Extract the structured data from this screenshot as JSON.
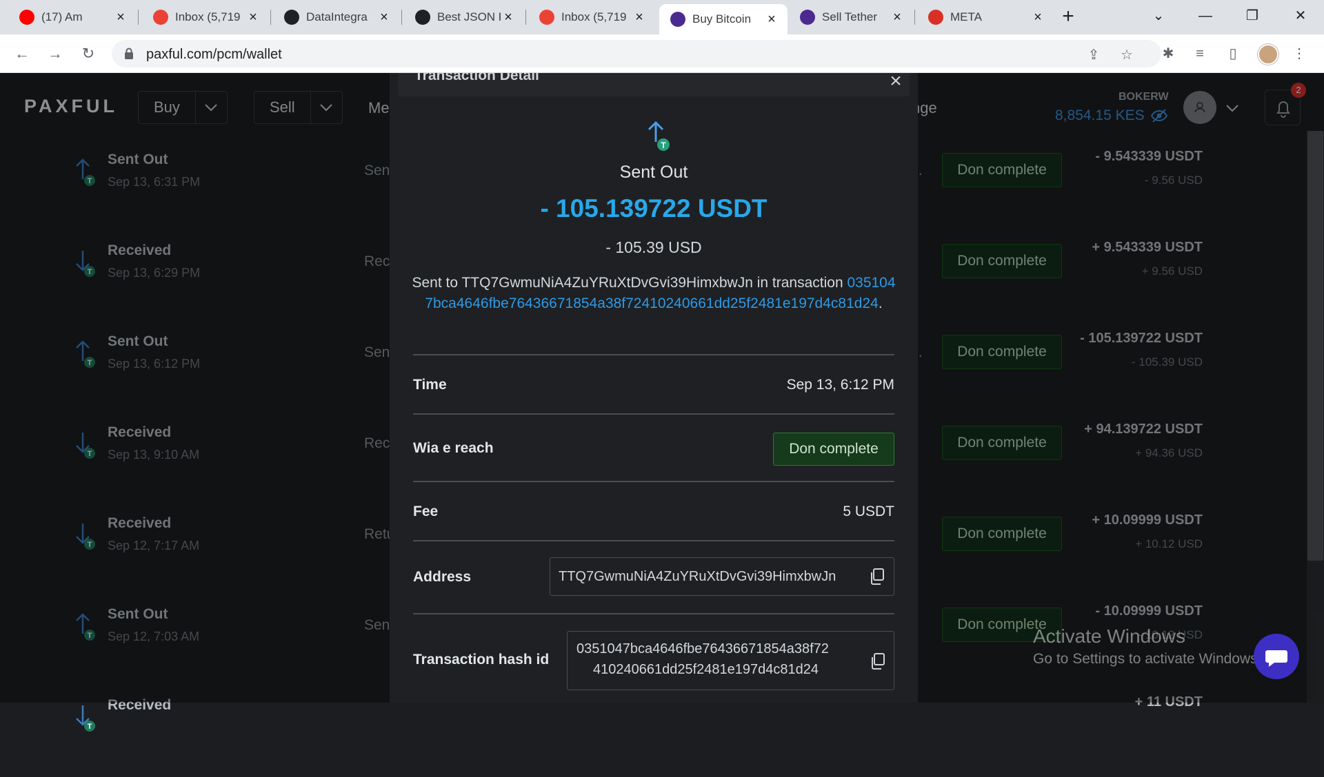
{
  "browser": {
    "tabs": [
      {
        "title": "(17) Am",
        "icon": "youtube-icon",
        "color": "#ff0000"
      },
      {
        "title": "Inbox (5,719",
        "icon": "gmail-icon",
        "color": "#ea4335"
      },
      {
        "title": "DataIntegra",
        "icon": "github-icon",
        "color": "#202124"
      },
      {
        "title": "Best JSON F",
        "icon": "jsonformatter-icon",
        "color": "#202124"
      },
      {
        "title": "Inbox (5,719",
        "icon": "gmail-icon",
        "color": "#ea4335"
      },
      {
        "title": "Buy Bitcoin",
        "icon": "paxful-icon",
        "color": "#4b2a8f",
        "active": true
      },
      {
        "title": "Sell Tether",
        "icon": "paxful-icon",
        "color": "#4b2a8f"
      },
      {
        "title": "META",
        "icon": "meta-trade-icon",
        "color": "#d93025"
      }
    ],
    "url": "paxful.com/pcm/wallet"
  },
  "header": {
    "logo": "PAXFUL",
    "nav": {
      "buy": "Buy",
      "sell": "Sell",
      "more": "Me",
      "exchange": "nge"
    },
    "username": "BOKERW",
    "balance": "8,854.15 KES",
    "notifications": "2"
  },
  "transactions": [
    {
      "label": "Sent Out",
      "date": "Sep 13, 6:31 PM",
      "desc": "Sen",
      "dots": "..",
      "status": "Don complete",
      "amount": "- 9.543339 USDT",
      "usd": "- 9.56  USD",
      "direction": "out"
    },
    {
      "label": "Received",
      "date": "Sep 13, 6:29 PM",
      "desc": "Rec",
      "dots": "",
      "status": "Don complete",
      "amount": "+ 9.543339 USDT",
      "usd": "+ 9.56  USD",
      "direction": "in"
    },
    {
      "label": "Sent Out",
      "date": "Sep 13, 6:12 PM",
      "desc": "Sen",
      "dots": "..",
      "status": "Don complete",
      "amount": "- 105.139722 USDT",
      "usd": "- 105.39  USD",
      "direction": "out"
    },
    {
      "label": "Received",
      "date": "Sep 13, 9:10 AM",
      "desc": "Rec",
      "dots": "",
      "status": "Don complete",
      "amount": "+ 94.139722 USDT",
      "usd": "+ 94.36  USD",
      "direction": "in"
    },
    {
      "label": "Received",
      "date": "Sep 12, 7:17 AM",
      "desc": "Retu",
      "dots": "",
      "status": "Don complete",
      "amount": "+ 10.09999 USDT",
      "usd": "+ 10.12  USD",
      "direction": "in"
    },
    {
      "label": "Sent Out",
      "date": "Sep 12, 7:03 AM",
      "desc": "Sen",
      "dots": "",
      "status": "Don complete",
      "amount": "- 10.09999 USDT",
      "usd": "- 10.12  USD",
      "direction": "out"
    },
    {
      "label": "Received",
      "date": "",
      "desc": "",
      "dots": "",
      "status": "",
      "amount": "+ 11 USDT",
      "usd": "",
      "direction": "in"
    }
  ],
  "modal": {
    "title": "Transaction Detail",
    "type": "Sent Out",
    "amount": "- 105.139722 USDT",
    "fiat": "- 105.39 USD",
    "desc_prefix": "Sent to TTQ7GwmuNiA4ZuYRuXtDvGvi39HimxbwJn in transaction",
    "desc_hash": "0351047bca4646fbe76436671854a38f72410240661dd25f2481e197d4c81d24",
    "desc_suffix": ".",
    "time_label": "Time",
    "time_value": "Sep 13, 6:12 PM",
    "status_label": "Wia e reach",
    "status_value": "Don complete",
    "fee_label": "Fee",
    "fee_value": "5 USDT",
    "address_label": "Address",
    "address_value": "TTQ7GwmuNiA4ZuYRuXtDvGvi39HimxbwJn",
    "hash_label": "Transaction hash id",
    "hash_line1": "0351047bca4646fbe76436671854a38f72",
    "hash_line2": "410240661dd25f2481e197d4c81d24"
  },
  "watermark": {
    "line1": "Activate Windows",
    "line2": "Go to Settings to activate Windows."
  },
  "colors": {
    "accent": "#28a8ea",
    "status_green": "#153a1c",
    "tether": "#26a17b"
  }
}
